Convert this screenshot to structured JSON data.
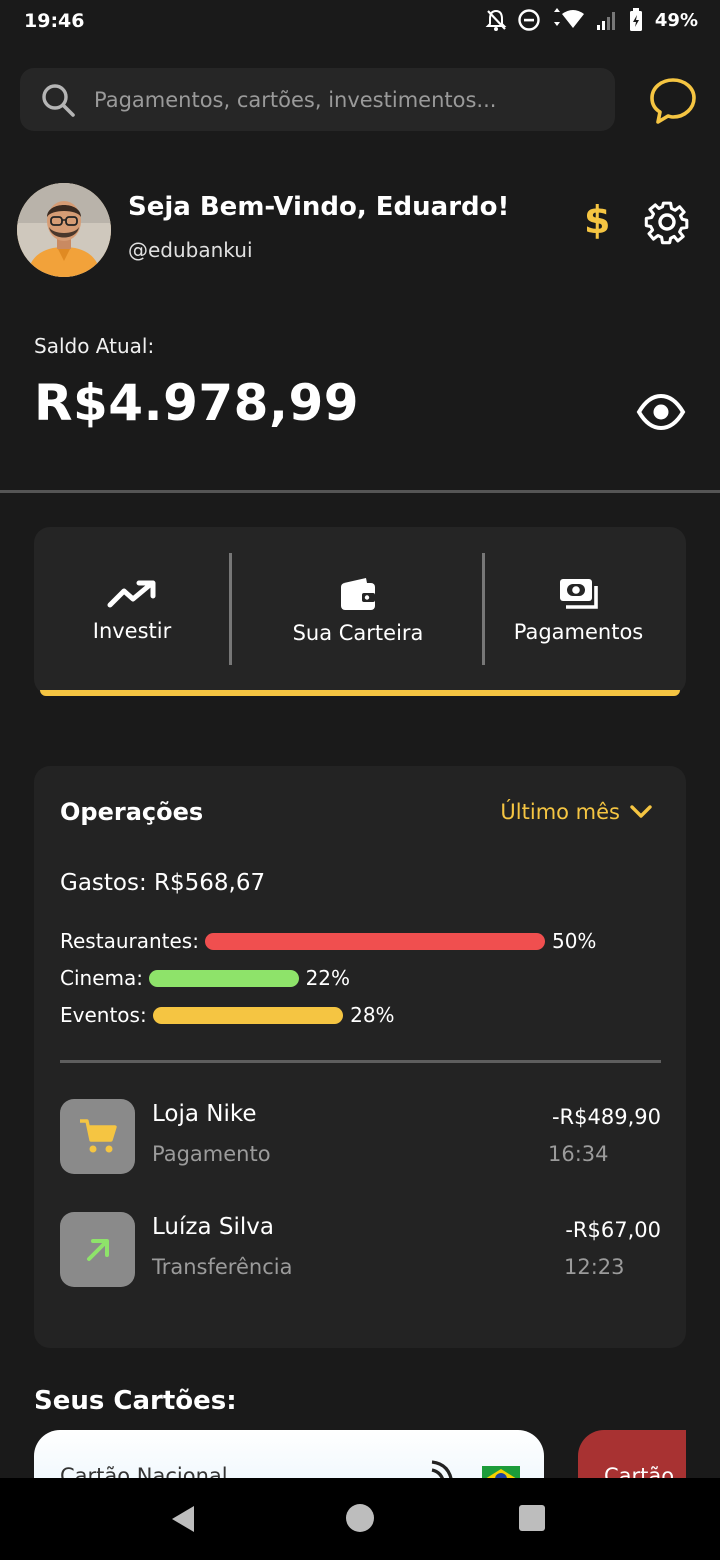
{
  "status_bar": {
    "time": "19:46",
    "battery": "49%"
  },
  "search": {
    "placeholder": "Pagamentos, cartões, investimentos..."
  },
  "profile": {
    "greeting": "Seja Bem-Vindo, Eduardo!",
    "handle": "@edubankui",
    "currency_symbol": "$"
  },
  "balance": {
    "label": "Saldo Atual:",
    "value": "R$4.978,99"
  },
  "actions": [
    {
      "label": "Investir",
      "icon": "trending-up-icon"
    },
    {
      "label": "Sua Carteira",
      "icon": "wallet-icon"
    },
    {
      "label": "Pagamentos",
      "icon": "payments-icon"
    }
  ],
  "operations": {
    "title": "Operações",
    "period": "Último mês",
    "spent": "Gastos: R$568,67",
    "categories": [
      {
        "label": "Restaurantes:",
        "percent": 50,
        "percent_label": "50%",
        "color": "#f04f4f"
      },
      {
        "label": "Cinema:",
        "percent": 22,
        "percent_label": "22%",
        "color": "#8ee36a"
      },
      {
        "label": "Eventos:",
        "percent": 28,
        "percent_label": "28%",
        "color": "#f5c542"
      }
    ],
    "transactions": [
      {
        "name": "Loja Nike",
        "type": "Pagamento",
        "amount": "-R$489,90",
        "time": "16:34",
        "icon": "cart-icon",
        "icon_color": "#f5c542"
      },
      {
        "name": "Luíza Silva",
        "type": "Transferência",
        "amount": "-R$67,00",
        "time": "12:23",
        "icon": "arrow-up-right-icon",
        "icon_color": "#8ee36a"
      }
    ]
  },
  "cards": {
    "title": "Seus Cartões:",
    "items": [
      {
        "name": "Cartão Nacional"
      },
      {
        "name": "Cartão"
      }
    ]
  },
  "colors": {
    "accent": "#f5c542",
    "background": "#1a1a1a",
    "surface": "#252525"
  }
}
